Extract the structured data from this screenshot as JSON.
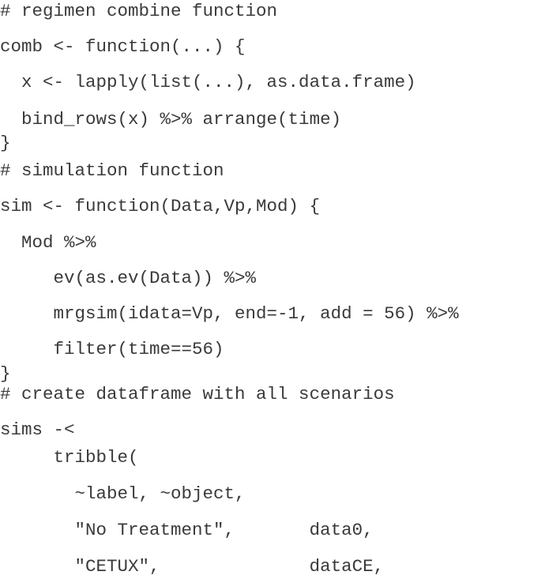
{
  "code": {
    "lines": [
      "# regimen combine function",
      "comb <- function(...) {",
      "  x <- lapply(list(...), as.data.frame)",
      "  bind_rows(x) %>% arrange(time)",
      "}",
      "# simulation function",
      "sim <- function(Data,Vp,Mod) {",
      "  Mod %>%",
      "     ev(as.ev(Data)) %>%",
      "     mrgsim(idata=Vp, end=-1, add = 56) %>%",
      "     filter(time==56)",
      "}",
      "# create dataframe with all scenarios",
      "sims -<",
      "     tribble(",
      "       ~label, ~object,",
      "       \"No Treatment\",       data0,",
      "       \"CETUX\",              dataCE,"
    ]
  }
}
